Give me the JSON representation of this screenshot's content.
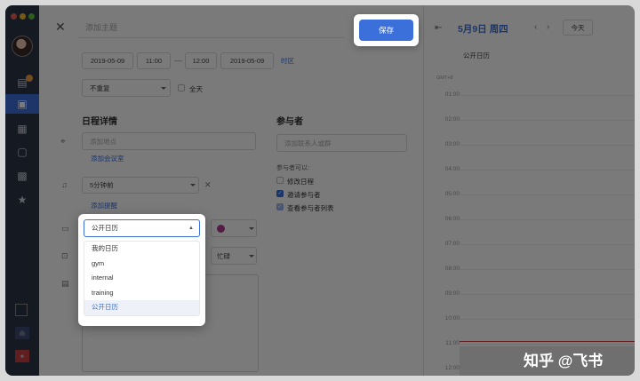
{
  "header": {
    "title_placeholder": "添加主题",
    "save_label": "保存"
  },
  "time": {
    "start_date": "2019-05-09",
    "start_time": "11:00",
    "separator": "—",
    "end_time": "12:00",
    "end_date": "2019-05-09",
    "timezone_label": "时区",
    "repeat": "不重复",
    "allday_label": "全天"
  },
  "details": {
    "section_title": "日程详情",
    "location_placeholder": "添加地点",
    "add_room": "添加会议室",
    "reminder": "5分钟前",
    "add_reminder": "添加提醒",
    "calendar_selected": "公开日历",
    "busy": "忙碌"
  },
  "attendees": {
    "section_title": "参与者",
    "input_placeholder": "添加联系人或群",
    "can_label": "参与者可以:",
    "options": [
      {
        "label": "修改日程",
        "checked": false
      },
      {
        "label": "邀请参与者",
        "checked": true
      },
      {
        "label": "查看参与者列表",
        "checked": true
      }
    ]
  },
  "dropdown": {
    "items": [
      "我的日历",
      "gym",
      "internal",
      "training",
      "公开日历"
    ]
  },
  "right_panel": {
    "collapse_icon": "collapse-left-icon",
    "date_title": "5月9日 周四",
    "today_label": "今天",
    "calendar_name": "公开日历",
    "timezone": "GMT+8",
    "hours": [
      "01:00",
      "02:00",
      "03:00",
      "04:00",
      "05:00",
      "06:00",
      "07:00",
      "08:00",
      "09:00",
      "10:00",
      "11:00",
      "12:00"
    ]
  },
  "watermark": "知乎 @飞书"
}
